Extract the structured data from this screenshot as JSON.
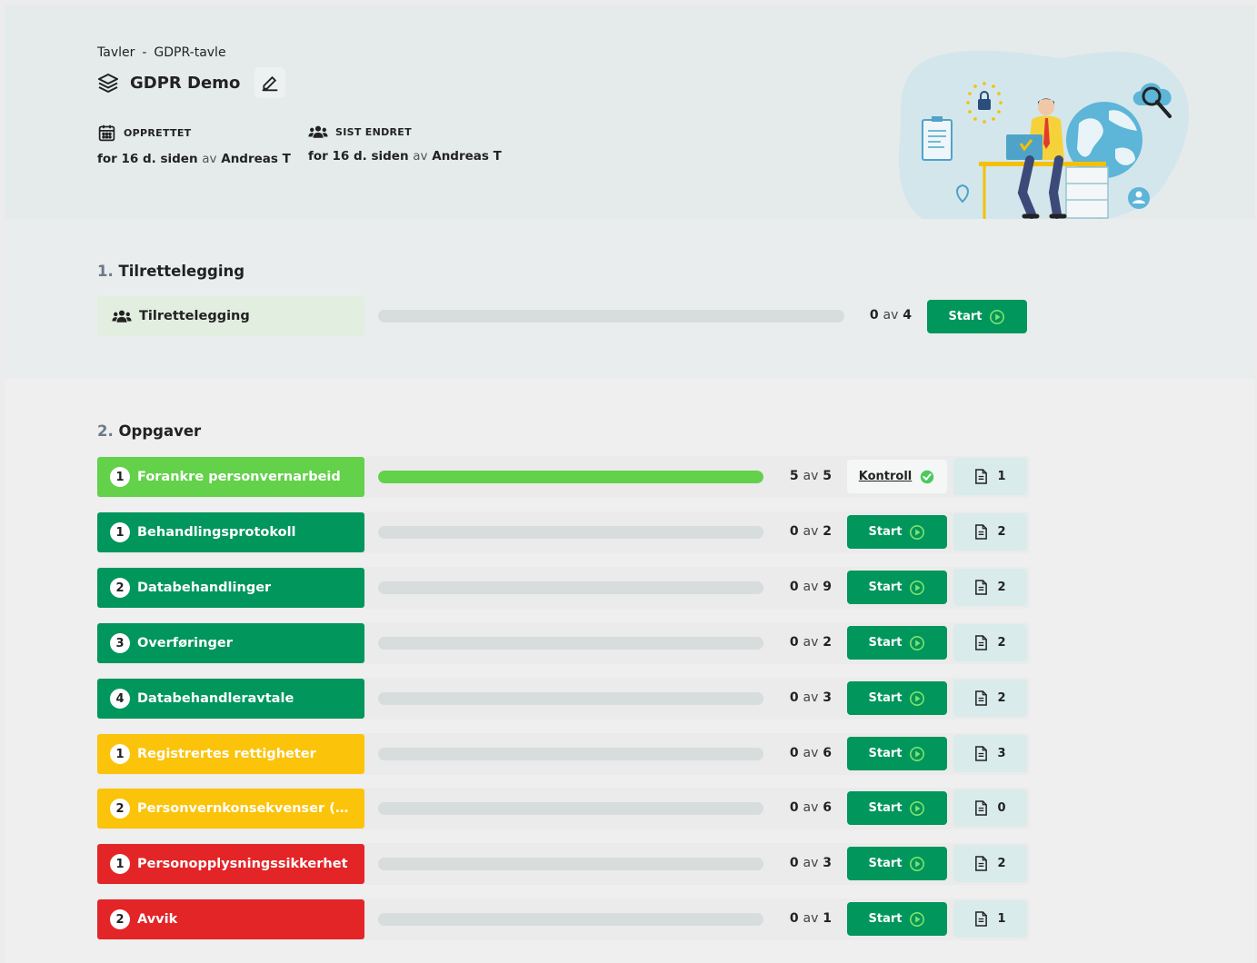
{
  "colors": {
    "green_dark": "#00965c",
    "green_light": "#63d14a",
    "yellow": "#fcc30b",
    "red": "#e32528",
    "doc_bg": "#d9ebeb"
  },
  "header": {
    "breadcrumb": {
      "parent": "Tavler",
      "separator": "-",
      "current": "GDPR-tavle"
    },
    "title": "GDPR Demo",
    "created": {
      "label": "OPPRETTET",
      "when": "for 16 d. siden",
      "av": "av",
      "who": "Andreas T"
    },
    "modified": {
      "label": "SIST ENDRET",
      "when": "for 16 d. siden",
      "av": "av",
      "who": "Andreas T"
    }
  },
  "section1": {
    "num": "1.",
    "title": "Tilrettelegging",
    "item": {
      "label": "Tilrettelegging",
      "done": "0",
      "av": "av",
      "total": "4",
      "progress": 0,
      "start_label": "Start"
    }
  },
  "section2": {
    "num": "2.",
    "title": "Oppgaver",
    "tasks": [
      {
        "badge": "1",
        "label": "Forankre personvernarbeid",
        "color": "#63d14a",
        "done": "5",
        "av": "av",
        "total": "5",
        "progress": 1.0,
        "action": "kontroll",
        "action_label": "Kontroll",
        "docs": "1"
      },
      {
        "badge": "1",
        "label": "Behandlingsprotokoll",
        "color": "#00965c",
        "done": "0",
        "av": "av",
        "total": "2",
        "progress": 0,
        "action": "start",
        "action_label": "Start",
        "docs": "2"
      },
      {
        "badge": "2",
        "label": "Databehandlinger",
        "color": "#00965c",
        "done": "0",
        "av": "av",
        "total": "9",
        "progress": 0,
        "action": "start",
        "action_label": "Start",
        "docs": "2"
      },
      {
        "badge": "3",
        "label": "Overføringer",
        "color": "#00965c",
        "done": "0",
        "av": "av",
        "total": "2",
        "progress": 0,
        "action": "start",
        "action_label": "Start",
        "docs": "2"
      },
      {
        "badge": "4",
        "label": "Databehandleravtale",
        "color": "#00965c",
        "done": "0",
        "av": "av",
        "total": "3",
        "progress": 0,
        "action": "start",
        "action_label": "Start",
        "docs": "2"
      },
      {
        "badge": "1",
        "label": "Registrertes rettigheter",
        "color": "#fcc30b",
        "done": "0",
        "av": "av",
        "total": "6",
        "progress": 0,
        "action": "start",
        "action_label": "Start",
        "docs": "3"
      },
      {
        "badge": "2",
        "label": "Personvernkonsekvenser (DPI...",
        "color": "#fcc30b",
        "done": "0",
        "av": "av",
        "total": "6",
        "progress": 0,
        "action": "start",
        "action_label": "Start",
        "docs": "0"
      },
      {
        "badge": "1",
        "label": "Personopplysningssikkerhet",
        "color": "#e32528",
        "done": "0",
        "av": "av",
        "total": "3",
        "progress": 0,
        "action": "start",
        "action_label": "Start",
        "docs": "2"
      },
      {
        "badge": "2",
        "label": "Avvik",
        "color": "#e32528",
        "done": "0",
        "av": "av",
        "total": "1",
        "progress": 0,
        "action": "start",
        "action_label": "Start",
        "docs": "1"
      }
    ]
  }
}
